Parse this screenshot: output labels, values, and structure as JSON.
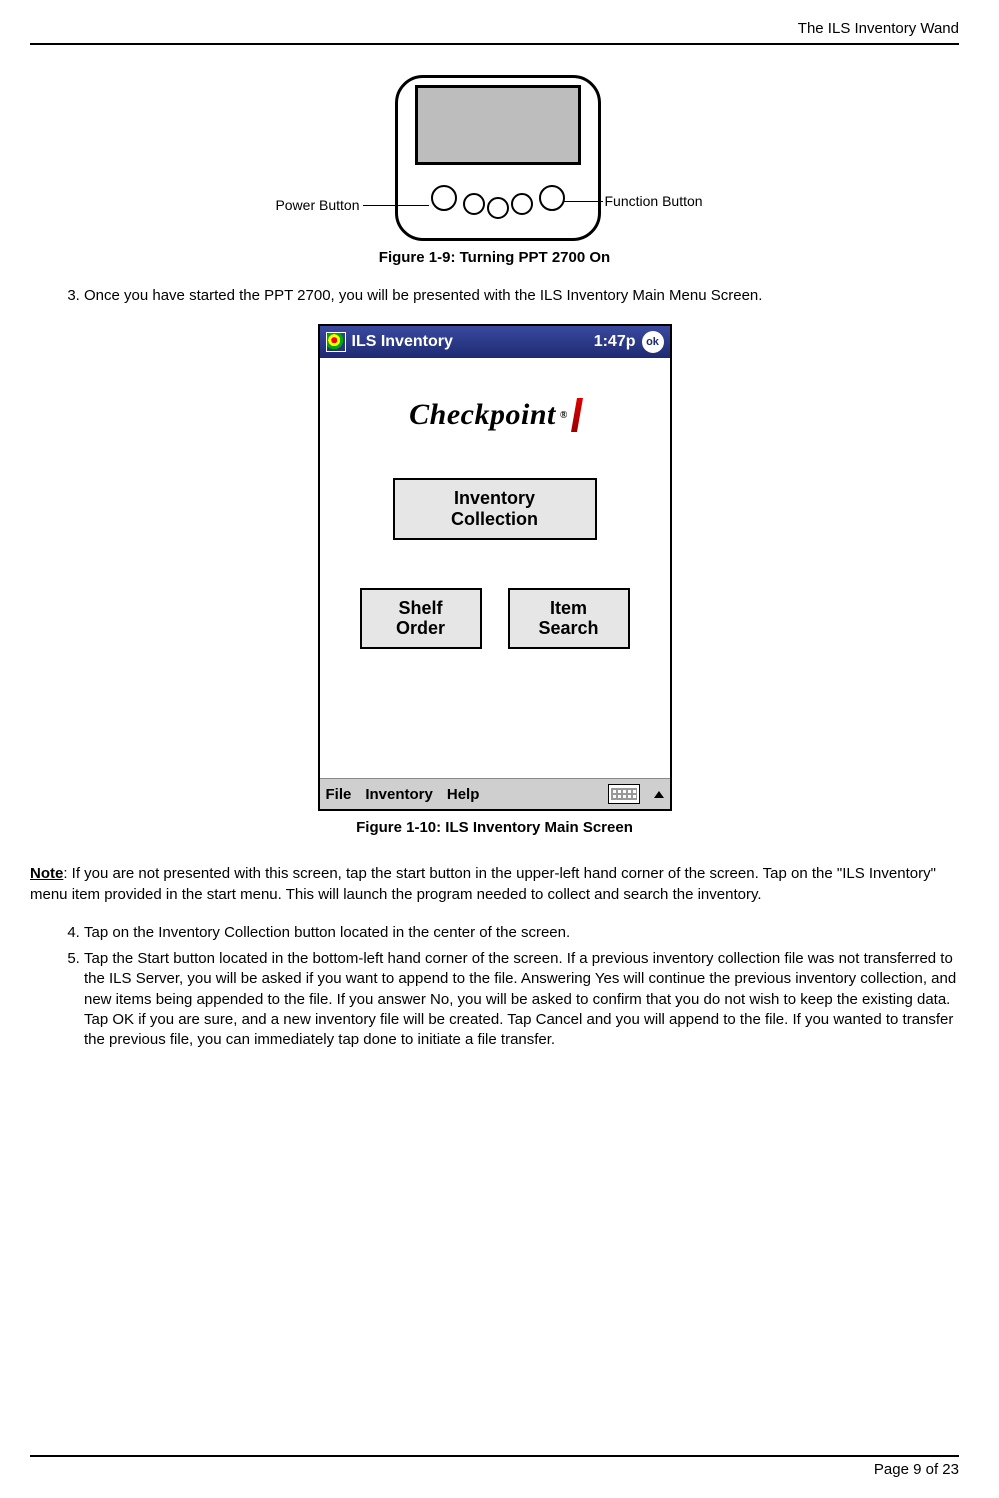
{
  "header": {
    "running_title": "The ILS Inventory Wand"
  },
  "figure1": {
    "caption": "Figure 1-9: Turning PPT 2700 On",
    "callout_left": "Power Button",
    "callout_right": "Function Button"
  },
  "steps_a": {
    "start": 3,
    "items": [
      "Once you have started the PPT 2700, you will be presented with the ILS Inventory Main Menu Screen."
    ]
  },
  "screenshot": {
    "titlebar_app": "ILS Inventory",
    "titlebar_time": "1:47p",
    "titlebar_ok": "ok",
    "brand": "Checkpoint",
    "buttons": {
      "inventory_collection_line1": "Inventory",
      "inventory_collection_line2": "Collection",
      "shelf_order_line1": "Shelf",
      "shelf_order_line2": "Order",
      "item_search_line1": "Item",
      "item_search_line2": "Search"
    },
    "menubar": {
      "file": "File",
      "inventory": "Inventory",
      "help": "Help"
    }
  },
  "figure2": {
    "caption": "Figure 1-10: ILS Inventory Main Screen"
  },
  "note": {
    "label": "Note",
    "text": ":  If you are not presented with this screen, tap the start button in the upper-left hand corner of the screen.  Tap on the \"ILS Inventory\" menu item provided in the start menu.  This will launch the program needed to collect and search the inventory."
  },
  "steps_b": {
    "start": 4,
    "items": [
      "Tap on the Inventory Collection button located in the center of the screen.",
      "Tap the Start button located in the bottom-left hand corner of the screen. If a previous inventory collection file was not transferred to the ILS Server, you will be asked if you want to append to the file. Answering Yes will continue the previous inventory collection, and new items being appended to the file. If you answer No, you will be asked to confirm that you do not wish to keep the existing data. Tap OK if you are sure, and a new inventory file will be created. Tap Cancel and you will append to the file. If you wanted to transfer the previous file, you can immediately tap done to initiate a file transfer."
    ]
  },
  "footer": {
    "page_label": "Page 9 of 23"
  }
}
